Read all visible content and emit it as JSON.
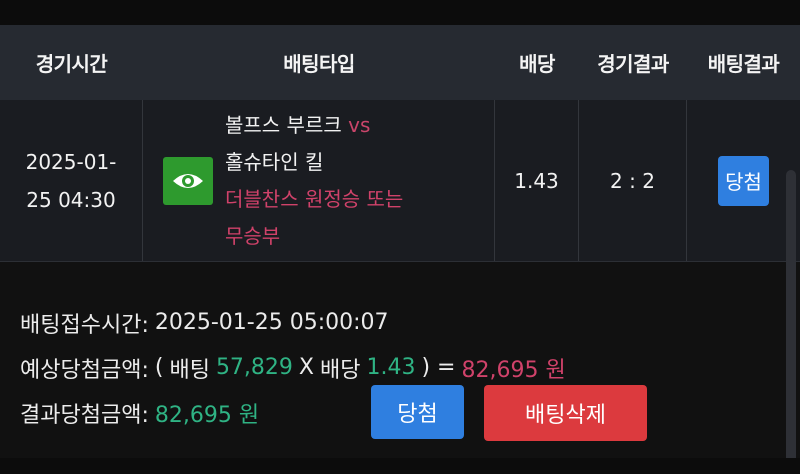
{
  "table": {
    "headers": [
      "경기시간",
      "배팅타입",
      "배당",
      "경기결과",
      "배팅결과"
    ],
    "row": {
      "time_date": "2025-01-",
      "time_clock": "25 04:30",
      "home_team": "볼프스 부르크",
      "vs": "vs",
      "away_team": "홀슈타인 킬",
      "pick_line1": "더블찬스 원정승 또는",
      "pick_line2": "무승부",
      "odds": "1.43",
      "score": "2 : 2",
      "result": "당첨",
      "icon": "eye-icon"
    }
  },
  "info": {
    "bet_time_label": "배팅접수시간:",
    "bet_time_value": "2025-01-25 05:00:07",
    "expected_label": "예상당첨금액:",
    "open_paren": "(",
    "bet_word": "배팅",
    "bet_amount": "57,829",
    "times": "X",
    "odds_word": "배당",
    "odds_value": "1.43",
    "close_eq": ") =",
    "expected_amount": "82,695 원",
    "result_label": "결과당첨금액:",
    "result_amount": "82,695 원"
  },
  "buttons": {
    "win_label": "당첨",
    "delete_label": "배팅삭제"
  },
  "colors": {
    "accent_blue": "#2f7fe0",
    "delete_red": "#dc3a3e",
    "green": "#2fb384",
    "pink": "#d0426a"
  }
}
